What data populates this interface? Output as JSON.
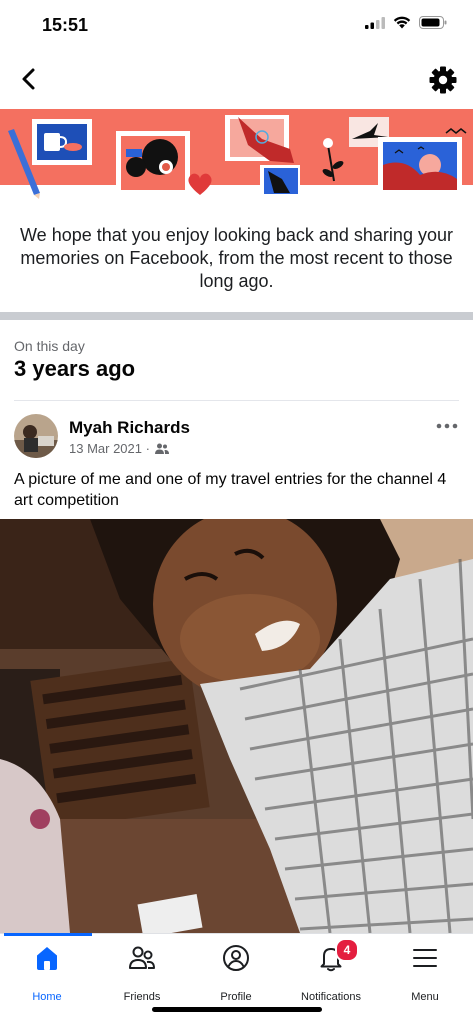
{
  "status_bar": {
    "time": "15:51",
    "signal_icon": "cellular-signal-icon",
    "wifi_icon": "wifi-icon",
    "battery_icon": "battery-icon"
  },
  "nav": {
    "back_icon": "chevron-left-icon",
    "settings_icon": "gear-icon"
  },
  "banner": {
    "description_icon": "memories-illustration"
  },
  "intro": {
    "text": "We hope that you enjoy looking back and sharing your memories on Facebook, from the most recent to those long ago."
  },
  "memory": {
    "section_label": "On this day",
    "years_ago": "3 years ago",
    "post": {
      "author": "Myah Richards",
      "date": "13 Mar 2021 ·",
      "audience_icon": "friends-audience-icon",
      "more_icon": "more-horizontal-icon",
      "text": "A picture of me and one of my travel entries for the channel 4 art competition"
    }
  },
  "tabs": [
    {
      "label": "Home",
      "icon": "home-icon",
      "active": true
    },
    {
      "label": "Friends",
      "icon": "friends-icon",
      "active": false
    },
    {
      "label": "Profile",
      "icon": "profile-icon",
      "active": false
    },
    {
      "label": "Notifications",
      "icon": "bell-icon",
      "active": false,
      "badge": "4"
    },
    {
      "label": "Menu",
      "icon": "menu-icon",
      "active": false
    }
  ],
  "colors": {
    "accent": "#0866ff",
    "badge": "#e41e3f",
    "banner": "#f47060"
  }
}
